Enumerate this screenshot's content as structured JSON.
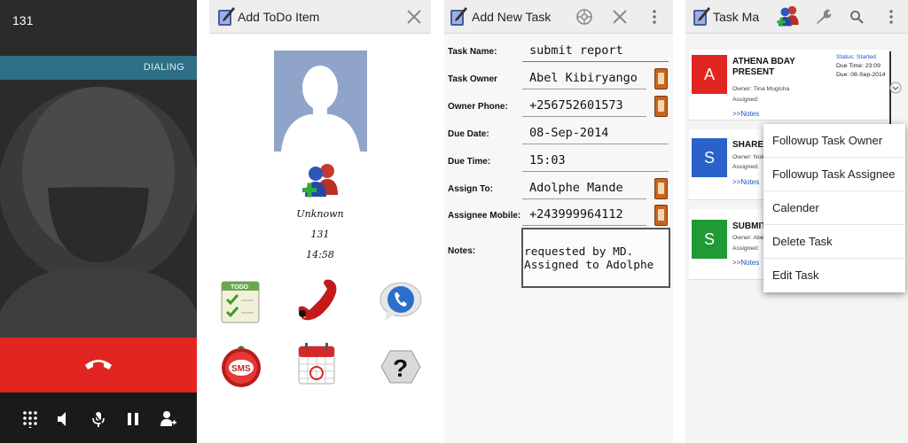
{
  "dialer": {
    "number": "131",
    "status": "DIALING",
    "colors": {
      "background": "#2b2b2b",
      "status_bar": "#2e6f86",
      "end_call": "#e32521"
    },
    "end_call_icon": "end-call-icon",
    "controls": [
      "dialpad-icon",
      "speaker-icon",
      "mute-icon",
      "hold-icon",
      "add-call-icon"
    ]
  },
  "add_todo": {
    "title": "Add ToDo Item",
    "contact": {
      "name": "Unknown",
      "number": "131",
      "time": "14:58"
    },
    "grid_icons": [
      "todo-list-icon",
      "call-icon",
      "phone-bubble-icon",
      "sms-icon",
      "calendar-icon",
      "help-icon"
    ]
  },
  "add_task": {
    "title": "Add New Task",
    "fields": [
      {
        "label": "Task Name:",
        "value": "submit report",
        "contact_button": false
      },
      {
        "label": "Task Owner",
        "value": "Abel Kibiryango",
        "contact_button": true
      },
      {
        "label": "Owner Phone:",
        "value": "+256752601573",
        "contact_button": true
      },
      {
        "label": "Due Date:",
        "value": "08-Sep-2014",
        "contact_button": false
      },
      {
        "label": "Due Time:",
        "value": "15:03",
        "contact_button": false
      },
      {
        "label": "Assign To:",
        "value": "Adolphe Mande",
        "contact_button": true
      },
      {
        "label": "Assignee Mobile:",
        "value": "+243999964112",
        "contact_button": true
      }
    ],
    "notes_label": "Notes:",
    "notes_value": "requested by MD.\nAssigned to Adolphe"
  },
  "task_manager": {
    "title": "Task Ma",
    "tasks": [
      {
        "letter": "A",
        "color": "#e32521",
        "title": "ATHENA BDAY PRESENT",
        "owner": "Owner: Tina Mugisha",
        "assigned": "Assigned:",
        "status": "Status: Started",
        "due_time": "Due Time: 23:09",
        "due_date": "Due: 08-Sep-2014",
        "notes": ">>Notes"
      },
      {
        "letter": "S",
        "color": "#2a62c9",
        "title": "SHARE",
        "owner": "Owner: Nok",
        "assigned": "Assigned:",
        "notes": ">>Notes"
      },
      {
        "letter": "S",
        "color": "#1f9a35",
        "title": "SUBMIT",
        "owner": "Owner: Abe",
        "assigned": "Assigned:",
        "notes": ">>Notes"
      }
    ],
    "menu": [
      "Followup Task Owner",
      "Followup Task Assignee",
      "Calender",
      "Delete Task",
      "Edit Task"
    ]
  }
}
